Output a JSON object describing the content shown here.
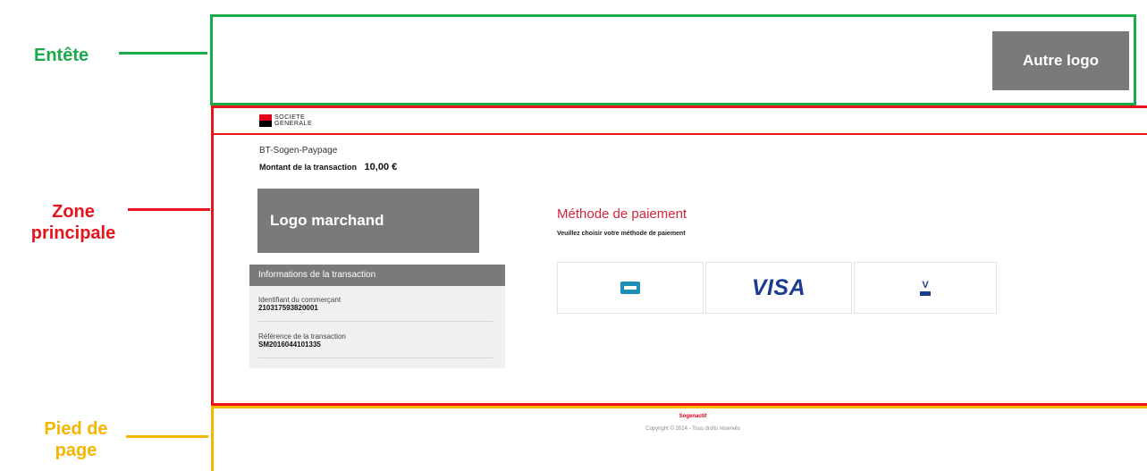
{
  "annotations": {
    "header_label": "Entête",
    "main_label": "Zone principale",
    "footer_label": "Pied de page"
  },
  "placeholders": {
    "other_logo": "Autre logo",
    "merchant_logo": "Logo marchand"
  },
  "bank": {
    "logo_line1": "SOCIETE",
    "logo_line2": "GENERALE"
  },
  "transaction": {
    "shop_name": "BT-Sogen-Paypage",
    "amount_label": "Montant de la transaction",
    "amount_value": "10,00 €"
  },
  "info_panel": {
    "title": "Informations de la transaction",
    "items": [
      {
        "label": "Identifiant du commerçant",
        "value": "210317593820001"
      },
      {
        "label": "Référence de la transaction",
        "value": "SM2016044101335"
      }
    ]
  },
  "payment": {
    "title": "Méthode de paiement",
    "subtitle": "Veuillez choisir votre méthode de paiement",
    "methods": [
      {
        "name": "CB",
        "icon": "cb-card-icon"
      },
      {
        "name": "VISA",
        "icon": "visa-logo"
      },
      {
        "name": "V PAY",
        "icon": "vpay-icon",
        "text": "V"
      }
    ]
  },
  "footer": {
    "brand": "Sogenactif",
    "copyright": "Copyright © 2014 - Tous droits réservés"
  },
  "colors": {
    "header_zone": "#1aaa4a",
    "main_zone": "#e8141b",
    "footer_zone": "#f7b500",
    "placeholder_gray": "#7a7a7a",
    "method_title": "#d0263a"
  }
}
